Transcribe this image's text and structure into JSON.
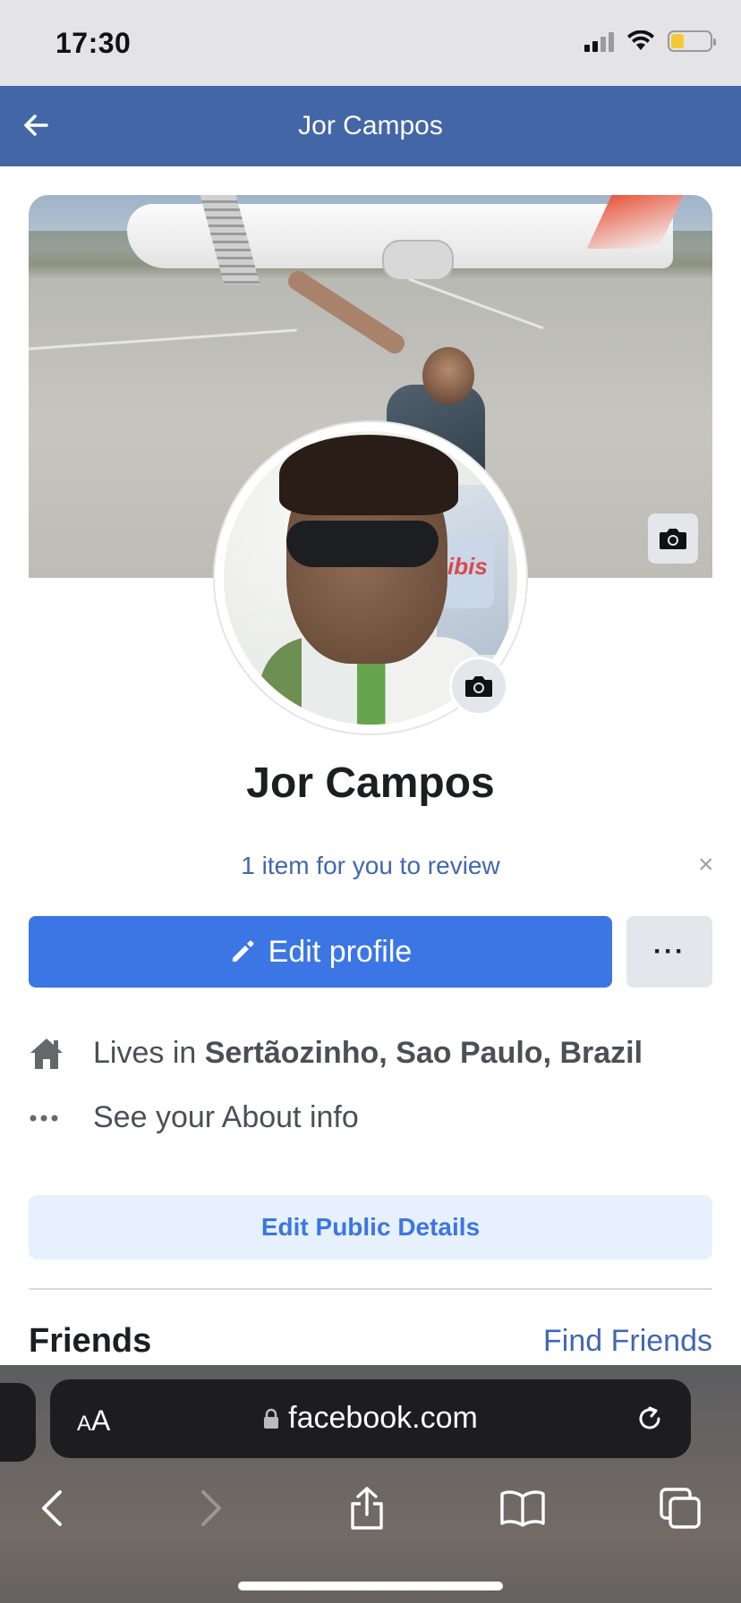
{
  "status_bar": {
    "time": "17:30"
  },
  "header": {
    "title": "Jor Campos"
  },
  "profile": {
    "name": "Jor Campos",
    "review_text": "1 item for you to review",
    "close_glyph": "×"
  },
  "actions": {
    "edit_profile_label": "Edit profile",
    "more_label": "···"
  },
  "about": {
    "lives_prefix": "Lives in ",
    "lives_location": "Sertãozinho, Sao Paulo, Brazil",
    "about_info_label": "See your About info",
    "edit_public_details_label": "Edit Public Details"
  },
  "friends": {
    "title": "Friends",
    "find_friends_label": "Find Friends"
  },
  "browser": {
    "text_size_small": "A",
    "text_size_big": "A",
    "url": "facebook.com"
  },
  "colors": {
    "header_bg": "#4366a6",
    "primary_button": "#3b76e4",
    "link": "#4267b2",
    "battery_fill": "#f5c836"
  },
  "icons": {
    "header_back": "arrow-left-icon",
    "cover_camera": "camera-icon",
    "avatar_camera": "camera-icon",
    "edit": "pencil-icon",
    "home": "home-icon",
    "more": "ellipsis-icon",
    "lock": "lock-icon",
    "reload": "reload-icon",
    "nav_back": "chevron-left-icon",
    "nav_forward": "chevron-right-icon",
    "share": "share-icon",
    "bookmarks": "book-icon",
    "tabs": "tabs-icon"
  }
}
